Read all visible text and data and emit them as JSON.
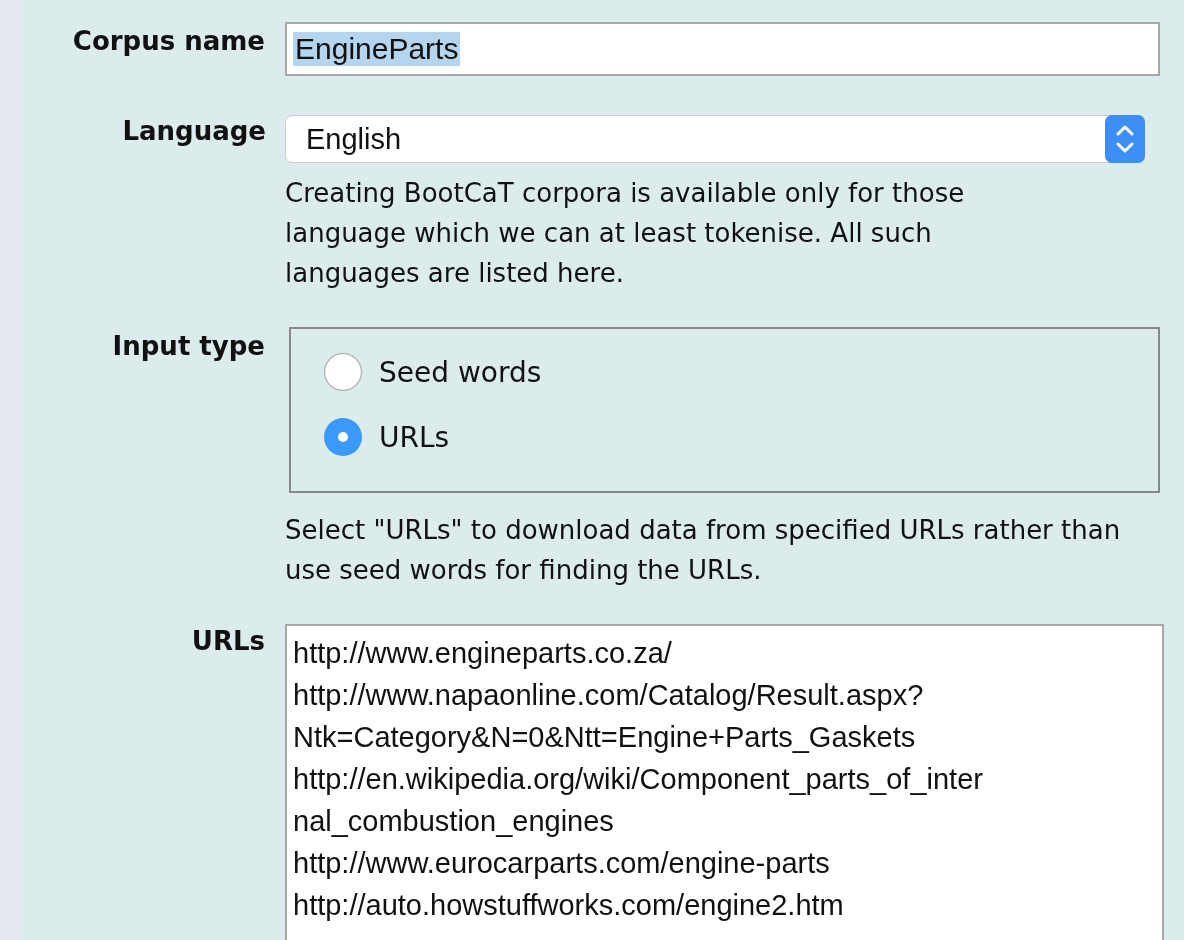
{
  "corpus_name": {
    "label": "Corpus name",
    "value": "EngineParts",
    "text_selected": true
  },
  "language": {
    "label": "Language",
    "value": "English",
    "help": "Creating BootCaT corpora is available only for those language which we can at least tokenise. All such languages are listed here."
  },
  "input_type": {
    "label": "Input type",
    "options": [
      {
        "label": "Seed words",
        "selected": false
      },
      {
        "label": "URLs",
        "selected": true
      }
    ],
    "help": "Select \"URLs\" to download data from specified URLs rather than use seed words for finding the URLs."
  },
  "urls": {
    "label": "URLs",
    "lines": [
      "http://www.engineparts.co.za/",
      "http://www.napaonline.com/Catalog/Result.aspx?",
      "Ntk=Category&N=0&Ntt=Engine+Parts_Gaskets",
      "http://en.wikipedia.org/wiki/Component_parts_of_inter",
      "nal_combustion_engines",
      "http://www.eurocarparts.com/engine-parts",
      "http://auto.howstuffworks.com/engine2.htm"
    ]
  }
}
